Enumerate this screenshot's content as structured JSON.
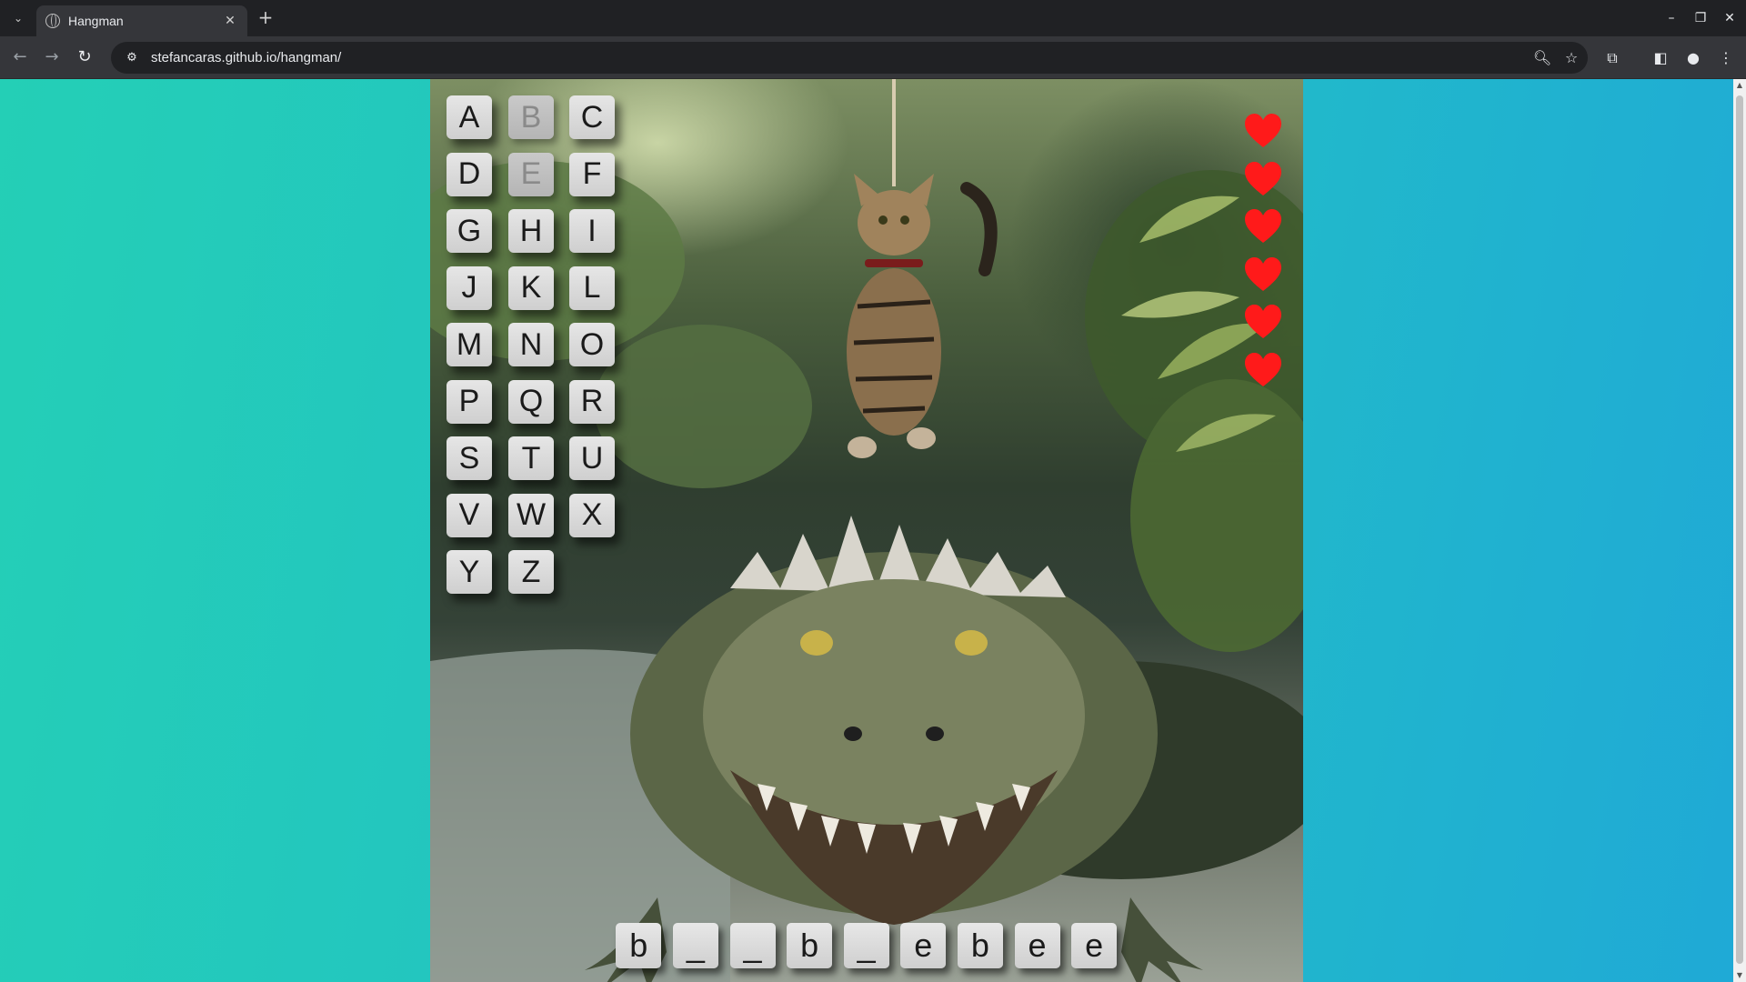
{
  "browser": {
    "tab_title": "Hangman",
    "url": "stefancaras.github.io/hangman/"
  },
  "game": {
    "keys": [
      {
        "letter": "A",
        "used": false
      },
      {
        "letter": "B",
        "used": true
      },
      {
        "letter": "C",
        "used": false
      },
      {
        "letter": "D",
        "used": false
      },
      {
        "letter": "E",
        "used": true
      },
      {
        "letter": "F",
        "used": false
      },
      {
        "letter": "G",
        "used": false
      },
      {
        "letter": "H",
        "used": false
      },
      {
        "letter": "I",
        "used": false
      },
      {
        "letter": "J",
        "used": false
      },
      {
        "letter": "K",
        "used": false
      },
      {
        "letter": "L",
        "used": false
      },
      {
        "letter": "M",
        "used": false
      },
      {
        "letter": "N",
        "used": false
      },
      {
        "letter": "O",
        "used": false
      },
      {
        "letter": "P",
        "used": false
      },
      {
        "letter": "Q",
        "used": false
      },
      {
        "letter": "R",
        "used": false
      },
      {
        "letter": "S",
        "used": false
      },
      {
        "letter": "T",
        "used": false
      },
      {
        "letter": "U",
        "used": false
      },
      {
        "letter": "V",
        "used": false
      },
      {
        "letter": "W",
        "used": false
      },
      {
        "letter": "X",
        "used": false
      },
      {
        "letter": "Y",
        "used": false
      },
      {
        "letter": "Z",
        "used": false
      }
    ],
    "lives": 6,
    "heart_color": "#ff1a1a",
    "word_slots": [
      "b",
      "_",
      "_",
      "b",
      "_",
      "e",
      "b",
      "e",
      "e"
    ]
  }
}
